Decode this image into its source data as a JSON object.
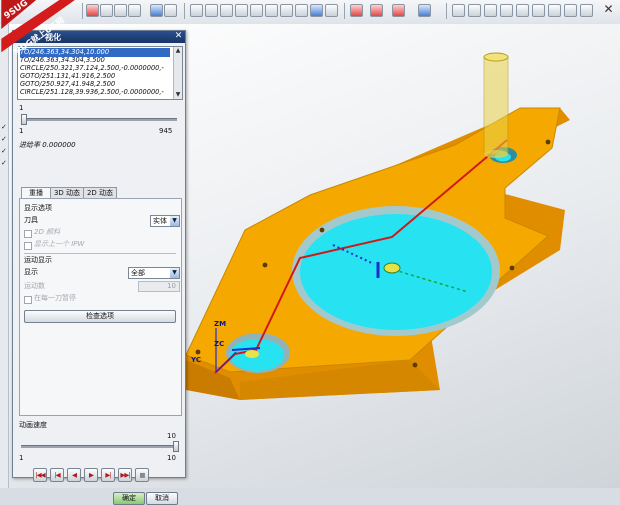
{
  "dialog": {
    "title": "视化",
    "toolpath_list": [
      "TO/246.363,34.304,10.000",
      "TO/246.363,34.304,3.500",
      "CIRCLE/250.321,37.124,2.500,-0.0000000,-",
      "GOTO/251.131,41.916,2.500",
      "GOTO/250.927,41.948,2.500",
      "CIRCLE/251.128,39.936,2.500,-0.0000000,-"
    ],
    "list_slider": {
      "min": "1",
      "max": "945",
      "value_fraction": 0.0
    },
    "feed_rate_label": "进给率 0.000000",
    "tabs": [
      "重播",
      "3D 动态",
      "2D 动态"
    ],
    "display_options": {
      "header": "显示选项",
      "tool_label": "刀具",
      "tool_value": "实体",
      "show_2d_material": "2D 颜料",
      "show_previous_ipw": "显示上一个 IPW"
    },
    "motion_display": {
      "header": "运动显示",
      "display_label": "显示",
      "display_value": "全部",
      "motion_count_label": "运动数",
      "motion_count_value": "10",
      "pause_each_label": "在每一刀暂停"
    },
    "check_options_button": "检查选项",
    "animation_speed": {
      "label": "动画速度",
      "min": "1",
      "max": "10",
      "value": "10",
      "value_fraction": 1.0
    },
    "playback_buttons": [
      "skip-to-start",
      "step-back",
      "play-backward",
      "play-forward",
      "step-forward",
      "skip-to-end",
      "stop"
    ],
    "ok_label": "确定",
    "cancel_label": "取消"
  },
  "viewport": {
    "axis_labels": {
      "zm": "ZM",
      "zc": "ZC",
      "yc": "YC"
    }
  },
  "watermark": {
    "line1": "9SUG",
    "line2": "学UG就上UG网"
  },
  "colors": {
    "part_orange": "#f5a800",
    "pocket_cyan": "#27e3f2",
    "toolpath_red": "#d01818",
    "tool_yellow": "#e8d24a",
    "dialog_title": "#1e3f7a"
  }
}
